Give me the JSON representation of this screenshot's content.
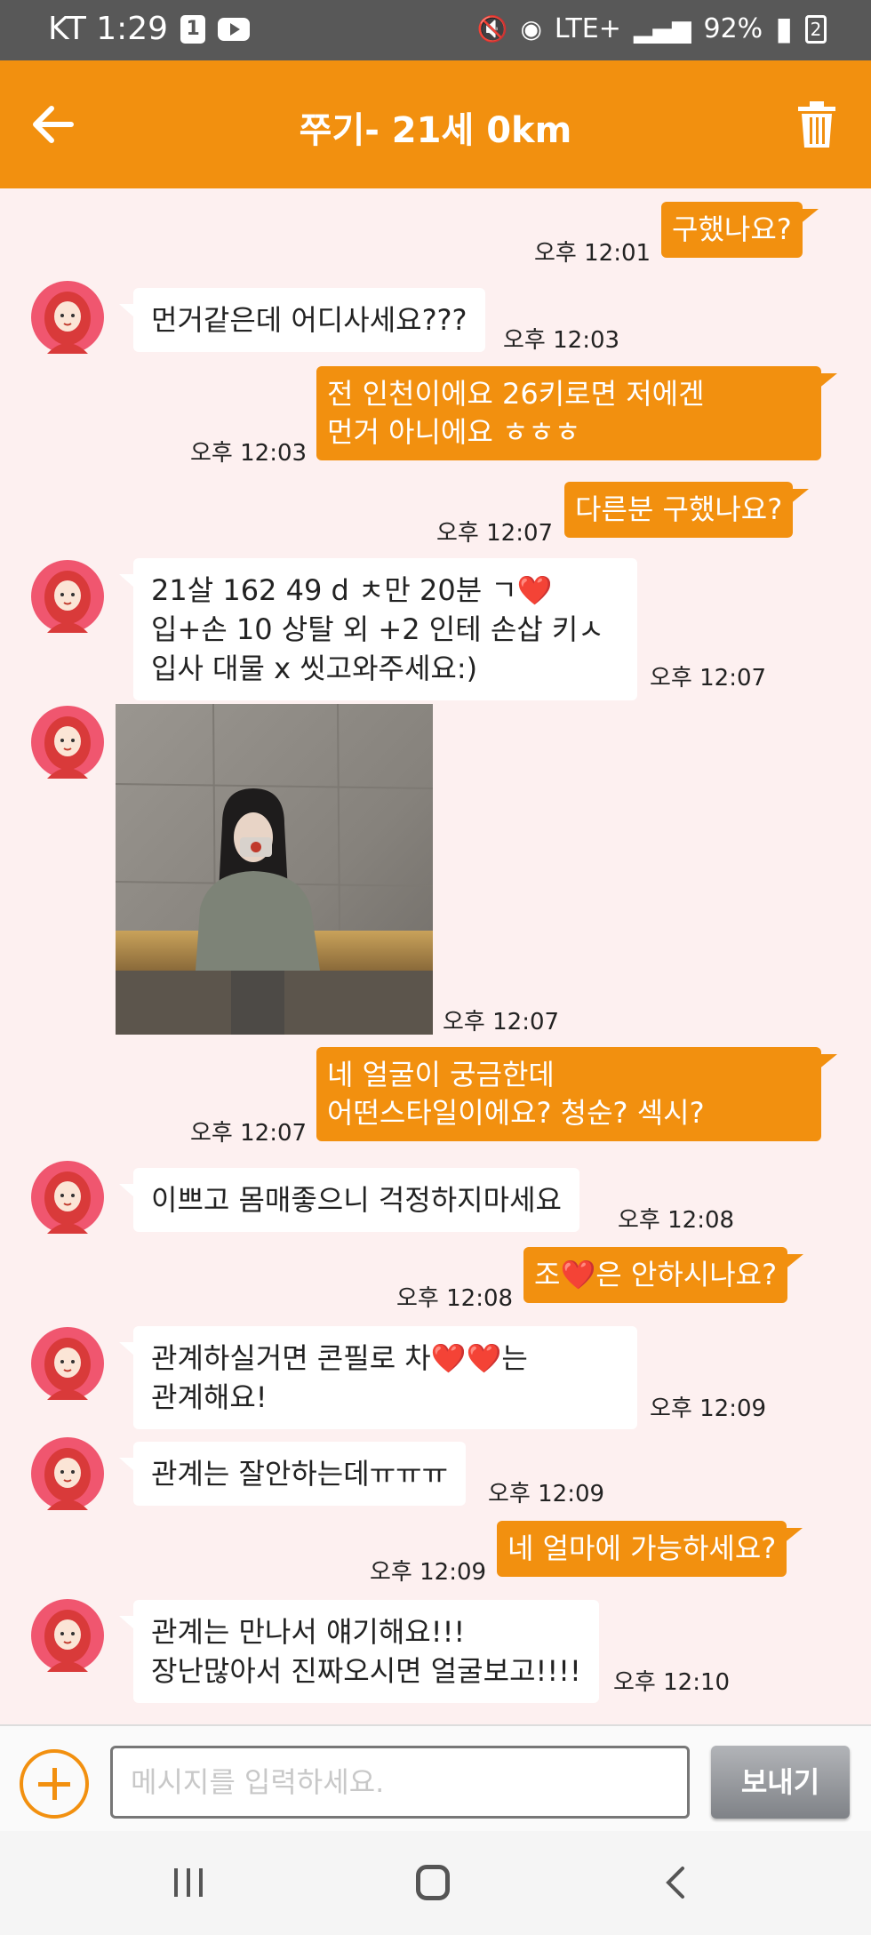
{
  "status_bar": {
    "carrier_time": "KT 1:29",
    "app_badge": "1",
    "network": "LTE+",
    "battery": "92%",
    "sim": "2"
  },
  "header": {
    "title": "쭈기- 21세 0km",
    "back_icon": "arrow-left-icon",
    "delete_icon": "trash-icon"
  },
  "colors": {
    "accent": "#f2900f",
    "chat_background": "#fdf0f0",
    "incoming_bubble": "#ffffff",
    "avatar": "#f0566f"
  },
  "messages": [
    {
      "from": "me",
      "text": "구했나요?",
      "time": "오후 12:01"
    },
    {
      "from": "partner",
      "text": "먼거같은데 어디사세요???",
      "time": "오후 12:03"
    },
    {
      "from": "me",
      "text": "전 인천이에요 26키로면 저에겐\n먼거 아니에요 ㅎㅎㅎ",
      "time": "오후 12:03"
    },
    {
      "from": "me",
      "text": "다른분 구했나요?",
      "time": "오후 12:07"
    },
    {
      "from": "partner",
      "text": "21살 162 49 d ㅊ만 20분 ㄱ❤️\n입+손 10 상탈 외 +2 인테 손삽 키ㅅ\n입사 대물 x 씻고와주세요:)",
      "time": "오후 12:07"
    },
    {
      "from": "partner",
      "type": "image",
      "image": "photo of a woman in a grey off-shoulder top taking a mirror selfie",
      "time": "오후 12:07"
    },
    {
      "from": "me",
      "text": "네 얼굴이 궁금한데\n어떤스타일이에요? 청순? 섹시?",
      "time": "오후 12:07"
    },
    {
      "from": "partner",
      "text": "이쁘고 몸매좋으니 걱정하지마세요",
      "time": "오후 12:08"
    },
    {
      "from": "me",
      "text": "조❤️은 안하시나요?",
      "time": "오후 12:08"
    },
    {
      "from": "partner",
      "text": "관계하실거면 콘필로 차❤️❤️는\n관계해요!",
      "time": "오후 12:09"
    },
    {
      "from": "partner",
      "text": "관계는 잘안하는데ㅠㅠㅠ",
      "time": "오후 12:09"
    },
    {
      "from": "me",
      "text": "네 얼마에 가능하세요?",
      "time": "오후 12:09"
    },
    {
      "from": "partner",
      "text": "관계는 만나서 얘기해요!!!\n장난많아서 진짜오시면 얼굴보고!!!!",
      "time": "오후 12:10"
    }
  ],
  "composer": {
    "placeholder": "메시지를 입력하세요.",
    "value": "",
    "send_label": "보내기",
    "attach_icon": "plus-circle-icon"
  },
  "nav_bar": {
    "recents_icon": "recents-icon",
    "home_icon": "home-icon",
    "back_icon": "back-chevron-icon"
  }
}
